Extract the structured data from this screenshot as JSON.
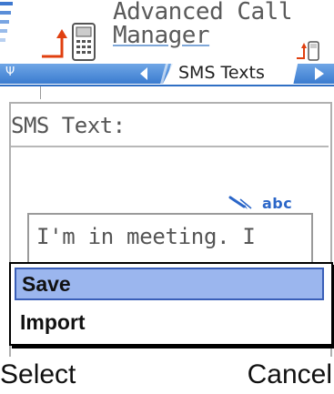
{
  "header": {
    "title_line1": "Advanced Call",
    "title_line2": "Manager",
    "tab": {
      "label": "SMS Texts"
    },
    "icons": [
      "signal-strength-icon",
      "call-manager-app-icon",
      "mini-app-icon",
      "left-arrow-icon",
      "right-arrow-icon"
    ]
  },
  "form": {
    "field_label": "SMS Text:",
    "input_mode": "abc",
    "input_value": "I'm in meeting. I"
  },
  "menu": {
    "items": [
      {
        "label": "Save",
        "selected": true
      },
      {
        "label": "Import",
        "selected": false
      }
    ]
  },
  "softkeys": {
    "left": "Select",
    "right": "Cancel"
  },
  "colors": {
    "accent": "#3a7bd0",
    "selection": "#9bb6ee",
    "indicator": "#2b66c8"
  }
}
